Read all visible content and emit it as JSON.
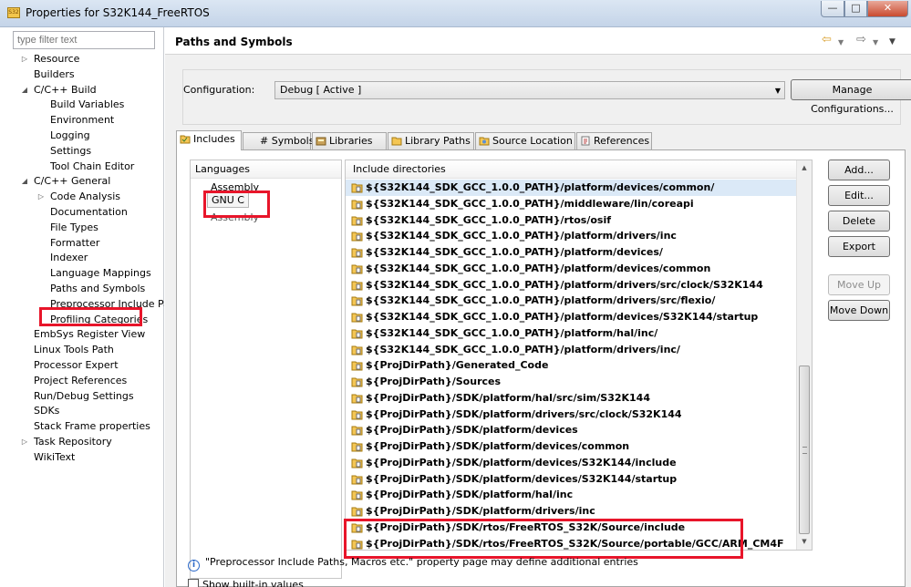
{
  "window": {
    "title": "Properties for S32K144_FreeRTOS",
    "icon_text": "S32",
    "minimize": "—",
    "maximize": "□",
    "close": "✕"
  },
  "left_pane": {
    "filter_placeholder": "type filter text",
    "tree": [
      {
        "label": "Resource",
        "level": 0,
        "expander": "▷"
      },
      {
        "label": "Builders",
        "level": 0,
        "expander": ""
      },
      {
        "label": "C/C++ Build",
        "level": 0,
        "expander": "◢"
      },
      {
        "label": "Build Variables",
        "level": 1,
        "expander": ""
      },
      {
        "label": "Environment",
        "level": 1,
        "expander": ""
      },
      {
        "label": "Logging",
        "level": 1,
        "expander": ""
      },
      {
        "label": "Settings",
        "level": 1,
        "expander": ""
      },
      {
        "label": "Tool Chain Editor",
        "level": 1,
        "expander": ""
      },
      {
        "label": "C/C++ General",
        "level": 0,
        "expander": "◢"
      },
      {
        "label": "Code Analysis",
        "level": 1,
        "expander": "▷"
      },
      {
        "label": "Documentation",
        "level": 1,
        "expander": ""
      },
      {
        "label": "File Types",
        "level": 1,
        "expander": ""
      },
      {
        "label": "Formatter",
        "level": 1,
        "expander": ""
      },
      {
        "label": "Indexer",
        "level": 1,
        "expander": ""
      },
      {
        "label": "Language Mappings",
        "level": 1,
        "expander": ""
      },
      {
        "label": "Paths and Symbols",
        "level": 1,
        "expander": ""
      },
      {
        "label": "Preprocessor Include Pa",
        "level": 1,
        "expander": ""
      },
      {
        "label": "Profiling Categories",
        "level": 1,
        "expander": ""
      },
      {
        "label": "EmbSys Register View",
        "level": 0,
        "expander": ""
      },
      {
        "label": "Linux Tools Path",
        "level": 0,
        "expander": ""
      },
      {
        "label": "Processor Expert",
        "level": 0,
        "expander": ""
      },
      {
        "label": "Project References",
        "level": 0,
        "expander": ""
      },
      {
        "label": "Run/Debug Settings",
        "level": 0,
        "expander": ""
      },
      {
        "label": "SDKs",
        "level": 0,
        "expander": ""
      },
      {
        "label": "Stack Frame properties",
        "level": 0,
        "expander": ""
      },
      {
        "label": "Task Repository",
        "level": 0,
        "expander": "▷"
      },
      {
        "label": "WikiText",
        "level": 0,
        "expander": ""
      }
    ]
  },
  "header": {
    "title": "Paths and Symbols",
    "back_icon": "⇦",
    "forward_icon": "⇨",
    "dropdown_icon": "▼",
    "menu_icon": "▼"
  },
  "configuration": {
    "label": "Configuration:",
    "value": "Debug  [ Active ]",
    "manage_button": "Manage Configurations..."
  },
  "tabs": [
    {
      "label": "Includes",
      "active": true
    },
    {
      "label": "# Symbols",
      "active": false
    },
    {
      "label": "Libraries",
      "active": false
    },
    {
      "label": "Library Paths",
      "active": false
    },
    {
      "label": "Source Location",
      "active": false
    },
    {
      "label": "References",
      "active": false
    }
  ],
  "languages": {
    "header": "Languages",
    "items": [
      "Assembly",
      "GNU C",
      "Assembly"
    ],
    "selected": "GNU C"
  },
  "include_directories": {
    "header": "Include directories",
    "items": [
      "${S32K144_SDK_GCC_1.0.0_PATH}/platform/devices/common/",
      "${S32K144_SDK_GCC_1.0.0_PATH}/middleware/lin/coreapi",
      "${S32K144_SDK_GCC_1.0.0_PATH}/rtos/osif",
      "${S32K144_SDK_GCC_1.0.0_PATH}/platform/drivers/inc",
      "${S32K144_SDK_GCC_1.0.0_PATH}/platform/devices/",
      "${S32K144_SDK_GCC_1.0.0_PATH}/platform/devices/common",
      "${S32K144_SDK_GCC_1.0.0_PATH}/platform/drivers/src/clock/S32K144",
      "${S32K144_SDK_GCC_1.0.0_PATH}/platform/drivers/src/flexio/",
      "${S32K144_SDK_GCC_1.0.0_PATH}/platform/devices/S32K144/startup",
      "${S32K144_SDK_GCC_1.0.0_PATH}/platform/hal/inc/",
      "${S32K144_SDK_GCC_1.0.0_PATH}/platform/drivers/inc/",
      "${ProjDirPath}/Generated_Code",
      "${ProjDirPath}/Sources",
      "${ProjDirPath}/SDK/platform/hal/src/sim/S32K144",
      "${ProjDirPath}/SDK/platform/drivers/src/clock/S32K144",
      "${ProjDirPath}/SDK/platform/devices",
      "${ProjDirPath}/SDK/platform/devices/common",
      "${ProjDirPath}/SDK/platform/devices/S32K144/include",
      "${ProjDirPath}/SDK/platform/devices/S32K144/startup",
      "${ProjDirPath}/SDK/platform/hal/inc",
      "${ProjDirPath}/SDK/platform/drivers/inc",
      "${ProjDirPath}/SDK/rtos/FreeRTOS_S32K/Source/include",
      "${ProjDirPath}/SDK/rtos/FreeRTOS_S32K/Source/portable/GCC/ARM_CM4F"
    ]
  },
  "buttons": {
    "add": "Add...",
    "edit": "Edit...",
    "delete": "Delete",
    "export": "Export",
    "move_up": "Move Up",
    "move_down": "Move Down"
  },
  "footer": {
    "info_text": "\"Preprocessor Include Paths, Macros etc.\" property page may define additional entries",
    "show_builtin": "Show built-in values"
  },
  "colors": {
    "annotation_red": "#e8152a",
    "selection": "#dbe9f7"
  }
}
